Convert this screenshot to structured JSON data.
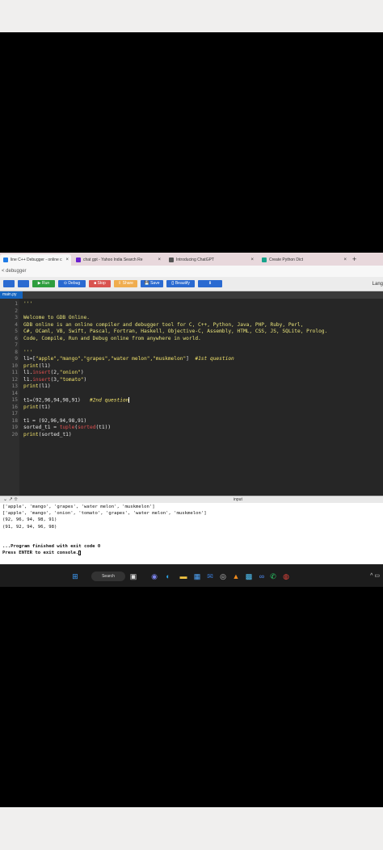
{
  "browser": {
    "tabs": [
      {
        "label": "line C++ Debugger - online c",
        "active": true,
        "favicon_color": "#1e7be6"
      },
      {
        "label": "chat gpt - Yahoo India Search Re",
        "active": false,
        "favicon_color": "#6a1fd0"
      },
      {
        "label": "Introducing ChatGPT",
        "active": false,
        "favicon_color": "#555555"
      },
      {
        "label": "Create Python Dict",
        "active": false,
        "favicon_color": "#19a38c"
      }
    ],
    "new_tab_label": "+",
    "close_glyph": "×",
    "page_label": "< debugger"
  },
  "toolbar": {
    "buttons": [
      {
        "label": "",
        "color": "#2a6ad1",
        "icon": "file-icon"
      },
      {
        "label": "",
        "color": "#2a6ad1",
        "icon": "upload-icon"
      },
      {
        "label": "▶ Run",
        "color": "#2e9e3e"
      },
      {
        "label": "⊙ Debug",
        "color": "#2a6ad1"
      },
      {
        "label": "■ Stop",
        "color": "#d9534f"
      },
      {
        "label": "⇪ Share",
        "color": "#f0ad4e"
      },
      {
        "label": "💾 Save",
        "color": "#2a6ad1"
      },
      {
        "label": "{} Beautify",
        "color": "#2a6ad1"
      },
      {
        "label": "⬇",
        "color": "#2a6ad1"
      }
    ],
    "language_label": "Lang"
  },
  "editor": {
    "file_tab": "main.py",
    "lines": [
      {
        "n": "1",
        "parts": [
          {
            "t": "'''",
            "c": "c-doc"
          }
        ]
      },
      {
        "n": "2",
        "parts": [
          {
            "t": "",
            "c": ""
          }
        ]
      },
      {
        "n": "3",
        "parts": [
          {
            "t": "Welcome to GDB Online.",
            "c": "c-doc"
          }
        ]
      },
      {
        "n": "4",
        "parts": [
          {
            "t": "GDB online is an online compiler and debugger tool for C, C++, Python, Java, PHP, Ruby, Perl,",
            "c": "c-doc"
          }
        ]
      },
      {
        "n": "5",
        "parts": [
          {
            "t": "C#, OCaml, VB, Swift, Pascal, Fortran, Haskell, Objective-C, Assembly, HTML, CSS, JS, SQLite, Prolog.",
            "c": "c-doc"
          }
        ]
      },
      {
        "n": "6",
        "parts": [
          {
            "t": "Code, Compile, Run and Debug online from anywhere in world.",
            "c": "c-doc"
          }
        ]
      },
      {
        "n": "7",
        "parts": [
          {
            "t": "",
            "c": ""
          }
        ]
      },
      {
        "n": "8",
        "parts": [
          {
            "t": "'''",
            "c": "c-doc"
          }
        ]
      },
      {
        "n": "9",
        "parts": [
          {
            "t": "l1=[",
            "c": ""
          },
          {
            "t": "\"apple\",\"mango\",\"grapes\",\"water melon\",\"muskmelon\"",
            "c": "c-str"
          },
          {
            "t": "]  ",
            "c": ""
          },
          {
            "t": "#1st question",
            "c": "c-cm"
          }
        ]
      },
      {
        "n": "10",
        "parts": [
          {
            "t": "print",
            "c": "c-fn"
          },
          {
            "t": "(l1)",
            "c": ""
          }
        ]
      },
      {
        "n": "11",
        "parts": [
          {
            "t": "l1.",
            "c": ""
          },
          {
            "t": "insert",
            "c": "c-call"
          },
          {
            "t": "(2,",
            "c": ""
          },
          {
            "t": "\"onion\"",
            "c": "c-str"
          },
          {
            "t": ")",
            "c": ""
          }
        ]
      },
      {
        "n": "12",
        "parts": [
          {
            "t": "l1.",
            "c": ""
          },
          {
            "t": "insert",
            "c": "c-call"
          },
          {
            "t": "(3,",
            "c": ""
          },
          {
            "t": "\"tomato\"",
            "c": "c-str"
          },
          {
            "t": ")",
            "c": ""
          }
        ]
      },
      {
        "n": "13",
        "parts": [
          {
            "t": "print",
            "c": "c-fn"
          },
          {
            "t": "(l1)",
            "c": ""
          }
        ]
      },
      {
        "n": "14",
        "parts": [
          {
            "t": "",
            "c": ""
          }
        ]
      },
      {
        "n": "15",
        "parts": [
          {
            "t": "t1=(92,96,94,98,91)   ",
            "c": ""
          },
          {
            "t": "#2nd question",
            "c": "c-cm"
          }
        ],
        "cursor": true
      },
      {
        "n": "16",
        "parts": [
          {
            "t": "print",
            "c": "c-fn"
          },
          {
            "t": "(t1)",
            "c": ""
          }
        ]
      },
      {
        "n": "17",
        "parts": [
          {
            "t": "",
            "c": ""
          }
        ]
      },
      {
        "n": "18",
        "parts": [
          {
            "t": "t1 = (92,96,94,98,91)",
            "c": ""
          }
        ]
      },
      {
        "n": "19",
        "parts": [
          {
            "t": "sorted_t1 = ",
            "c": ""
          },
          {
            "t": "tuple",
            "c": "c-call"
          },
          {
            "t": "(",
            "c": ""
          },
          {
            "t": "sorted",
            "c": "c-call"
          },
          {
            "t": "(t1))",
            "c": ""
          }
        ]
      },
      {
        "n": "20",
        "parts": [
          {
            "t": "print",
            "c": "c-fn"
          },
          {
            "t": "(sorted_t1)",
            "c": ""
          }
        ]
      }
    ]
  },
  "output": {
    "panel_label": "input",
    "icons": "⌄ ↗ ⯐",
    "lines": [
      {
        "text": "['apple', 'mango', 'grapes', 'water melon', 'muskmelon']",
        "bold": false
      },
      {
        "text": "['apple', 'mango', 'onion', 'tomato', 'grapes', 'water melon', 'muskmelon']",
        "bold": false
      },
      {
        "text": "(92, 96, 94, 98, 91)",
        "bold": false
      },
      {
        "text": "(91, 92, 94, 96, 98)",
        "bold": false
      },
      {
        "text": "",
        "bold": false
      },
      {
        "text": "",
        "bold": false
      },
      {
        "text": "...Program finished with exit code 0",
        "bold": true
      },
      {
        "text": "Press ENTER to exit console.",
        "bold": true,
        "caret": true
      }
    ]
  },
  "taskbar": {
    "search_label": "Search",
    "icons": [
      {
        "name": "windows-start-icon",
        "glyph": "⊞",
        "color": "#3fa0ff"
      },
      {
        "name": "task-view-icon",
        "glyph": "▣",
        "color": "#dddddd"
      },
      {
        "name": "chat-icon",
        "glyph": "◉",
        "color": "#7b83eb"
      },
      {
        "name": "edge-browser-icon",
        "glyph": "◐",
        "color": "#2ba3e6"
      },
      {
        "name": "file-explorer-icon",
        "glyph": "▬",
        "color": "#f4c542"
      },
      {
        "name": "store-icon",
        "glyph": "▦",
        "color": "#4fa3f7"
      },
      {
        "name": "mail-icon",
        "glyph": "✉",
        "color": "#3a7bd5"
      },
      {
        "name": "dell-icon",
        "glyph": "◎",
        "color": "#cccccc"
      },
      {
        "name": "vlc-icon",
        "glyph": "▲",
        "color": "#f08a1c"
      },
      {
        "name": "photos-icon",
        "glyph": "▩",
        "color": "#4fc3f7"
      },
      {
        "name": "link-icon",
        "glyph": "∞",
        "color": "#4f8ef7"
      },
      {
        "name": "whatsapp-icon",
        "glyph": "✆",
        "color": "#2bd36a"
      },
      {
        "name": "chrome-icon",
        "glyph": "◍",
        "color": "#e8453c"
      }
    ],
    "tray_glyph": "^ ▭"
  }
}
